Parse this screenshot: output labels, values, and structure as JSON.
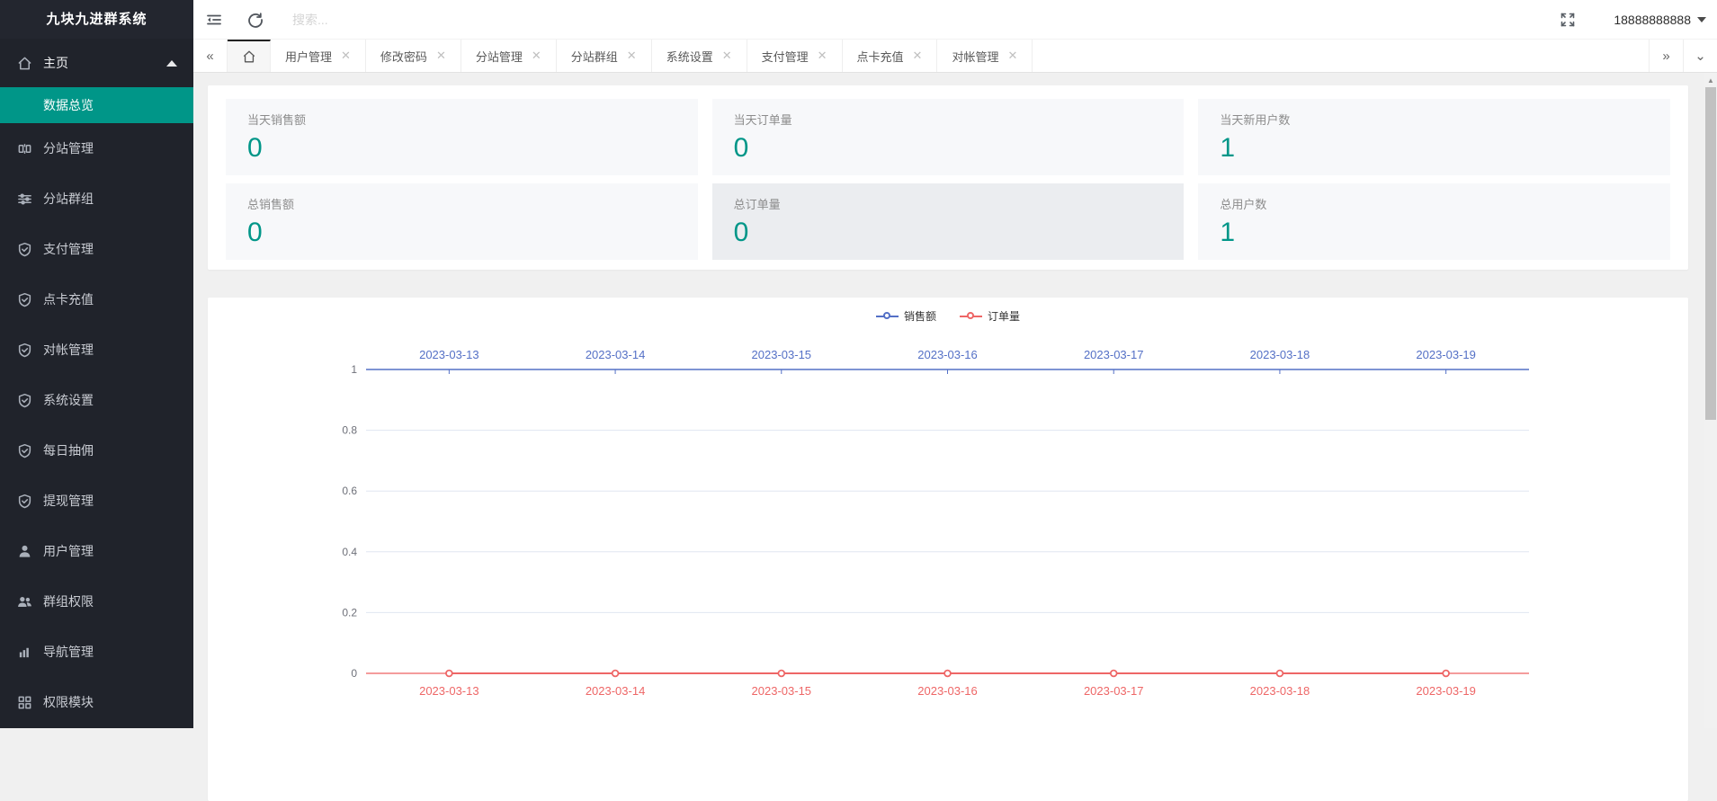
{
  "app": {
    "title": "九块九进群系统",
    "user_phone": "18888888888"
  },
  "topbar": {
    "search_placeholder": "搜索..."
  },
  "sidebar": {
    "home": {
      "label": "主页"
    },
    "active_sub": {
      "label": "数据总览"
    },
    "items": [
      {
        "label": "分站管理",
        "icon": "columns-icon"
      },
      {
        "label": "分站群组",
        "icon": "sliders-icon"
      },
      {
        "label": "支付管理",
        "icon": "shield-check-icon"
      },
      {
        "label": "点卡充值",
        "icon": "shield-check-icon"
      },
      {
        "label": "对帐管理",
        "icon": "shield-check-icon"
      },
      {
        "label": "系统设置",
        "icon": "shield-check-icon"
      },
      {
        "label": "每日抽佣",
        "icon": "shield-check-icon"
      },
      {
        "label": "提现管理",
        "icon": "shield-check-icon"
      },
      {
        "label": "用户管理",
        "icon": "user-icon"
      },
      {
        "label": "群组权限",
        "icon": "users-icon"
      },
      {
        "label": "导航管理",
        "icon": "bars-icon"
      },
      {
        "label": "权限模块",
        "icon": "grid-icon"
      }
    ]
  },
  "tabs": {
    "items": [
      "用户管理",
      "修改密码",
      "分站管理",
      "分站群组",
      "系统设置",
      "支付管理",
      "点卡充值",
      "对帐管理"
    ]
  },
  "stats": {
    "cards": [
      {
        "label": "当天销售额",
        "value": "0"
      },
      {
        "label": "当天订单量",
        "value": "0"
      },
      {
        "label": "当天新用户数",
        "value": "1"
      },
      {
        "label": "总销售额",
        "value": "0"
      },
      {
        "label": "总订单量",
        "value": "0",
        "darker": true
      },
      {
        "label": "总用户数",
        "value": "1"
      }
    ]
  },
  "chart_data": {
    "type": "line",
    "categories": [
      "2023-03-13",
      "2023-03-14",
      "2023-03-15",
      "2023-03-16",
      "2023-03-17",
      "2023-03-18",
      "2023-03-19"
    ],
    "series": [
      {
        "name": "销售额",
        "color": "#5470c6",
        "values": [
          0,
          0,
          0,
          0,
          0,
          0,
          0
        ],
        "axis": "top"
      },
      {
        "name": "订单量",
        "color": "#ee6666",
        "values": [
          0,
          0,
          0,
          0,
          0,
          0,
          0
        ],
        "axis": "bottom"
      }
    ],
    "ylabel": "",
    "xlabel": "",
    "ylim": [
      0,
      1
    ],
    "yticks": [
      0,
      0.2,
      0.4,
      0.6,
      0.8,
      1
    ],
    "grid": true,
    "legend_position": "top-center",
    "grid_color": "#e0e6f1",
    "tick_label_color": "#6e7079"
  },
  "colors": {
    "accent_teal": "#009688",
    "sidebar_bg": "#20232b",
    "series_blue": "#5470c6",
    "series_red": "#ee6666"
  }
}
